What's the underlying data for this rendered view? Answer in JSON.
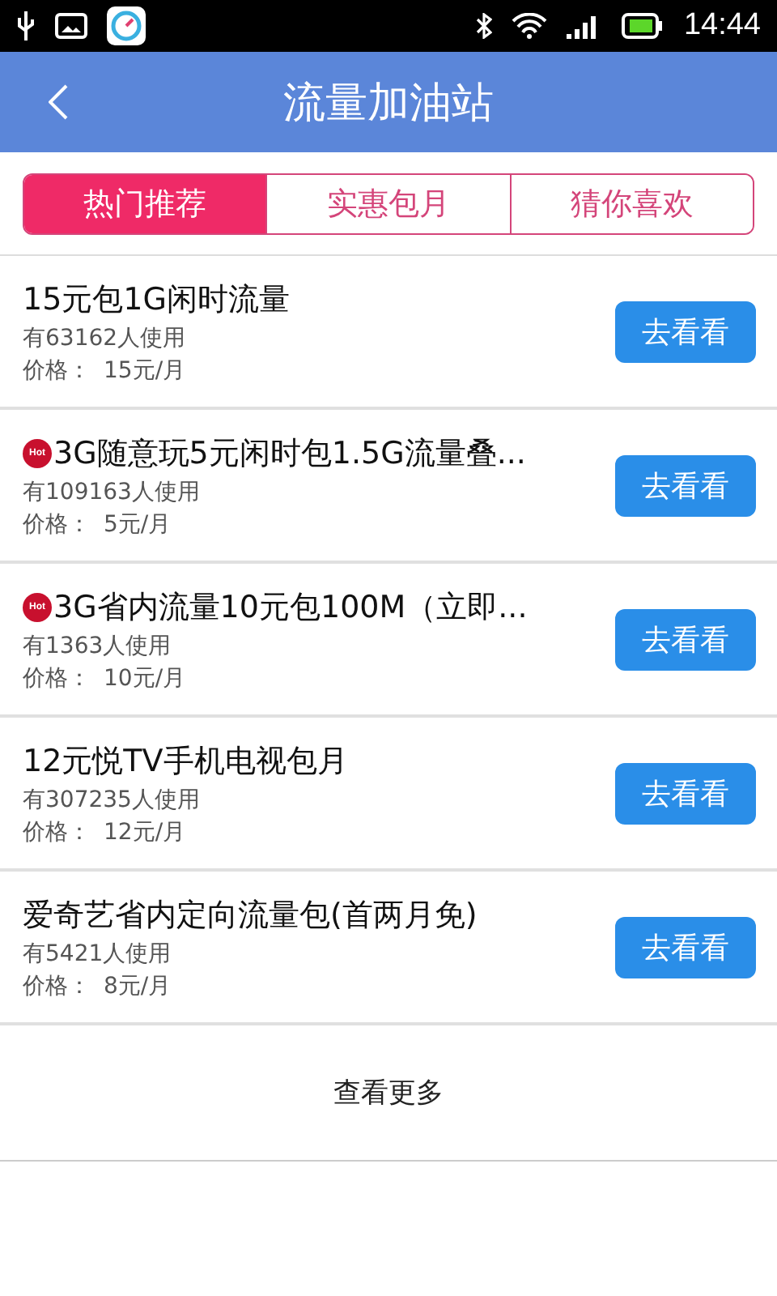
{
  "status_bar": {
    "time": "14:44"
  },
  "header": {
    "title": "流量加油站"
  },
  "tabs": [
    {
      "label": "热门推荐",
      "selected": true
    },
    {
      "label": "实惠包月",
      "selected": false
    },
    {
      "label": "猜你喜欢",
      "selected": false
    }
  ],
  "items": [
    {
      "title": "15元包1G闲时流量",
      "hot": false,
      "users": "有63162人使用",
      "price_label": "价格：",
      "price": "15元/月",
      "button": "去看看"
    },
    {
      "title": "3G随意玩5元闲时包1.5G流量叠...",
      "hot": true,
      "badge": "Hot",
      "users": "有109163人使用",
      "price_label": "价格：",
      "price": "5元/月",
      "button": "去看看"
    },
    {
      "title": "3G省内流量10元包100M（立即...",
      "hot": true,
      "badge": "Hot",
      "users": "有1363人使用",
      "price_label": "价格：",
      "price": "10元/月",
      "button": "去看看"
    },
    {
      "title": "12元悦TV手机电视包月",
      "hot": false,
      "users": "有307235人使用",
      "price_label": "价格：",
      "price": "12元/月",
      "button": "去看看"
    },
    {
      "title": "爱奇艺省内定向流量包(首两月免)",
      "hot": false,
      "users": "有5421人使用",
      "price_label": "价格：",
      "price": "8元/月",
      "button": "去看看"
    }
  ],
  "more": "查看更多"
}
